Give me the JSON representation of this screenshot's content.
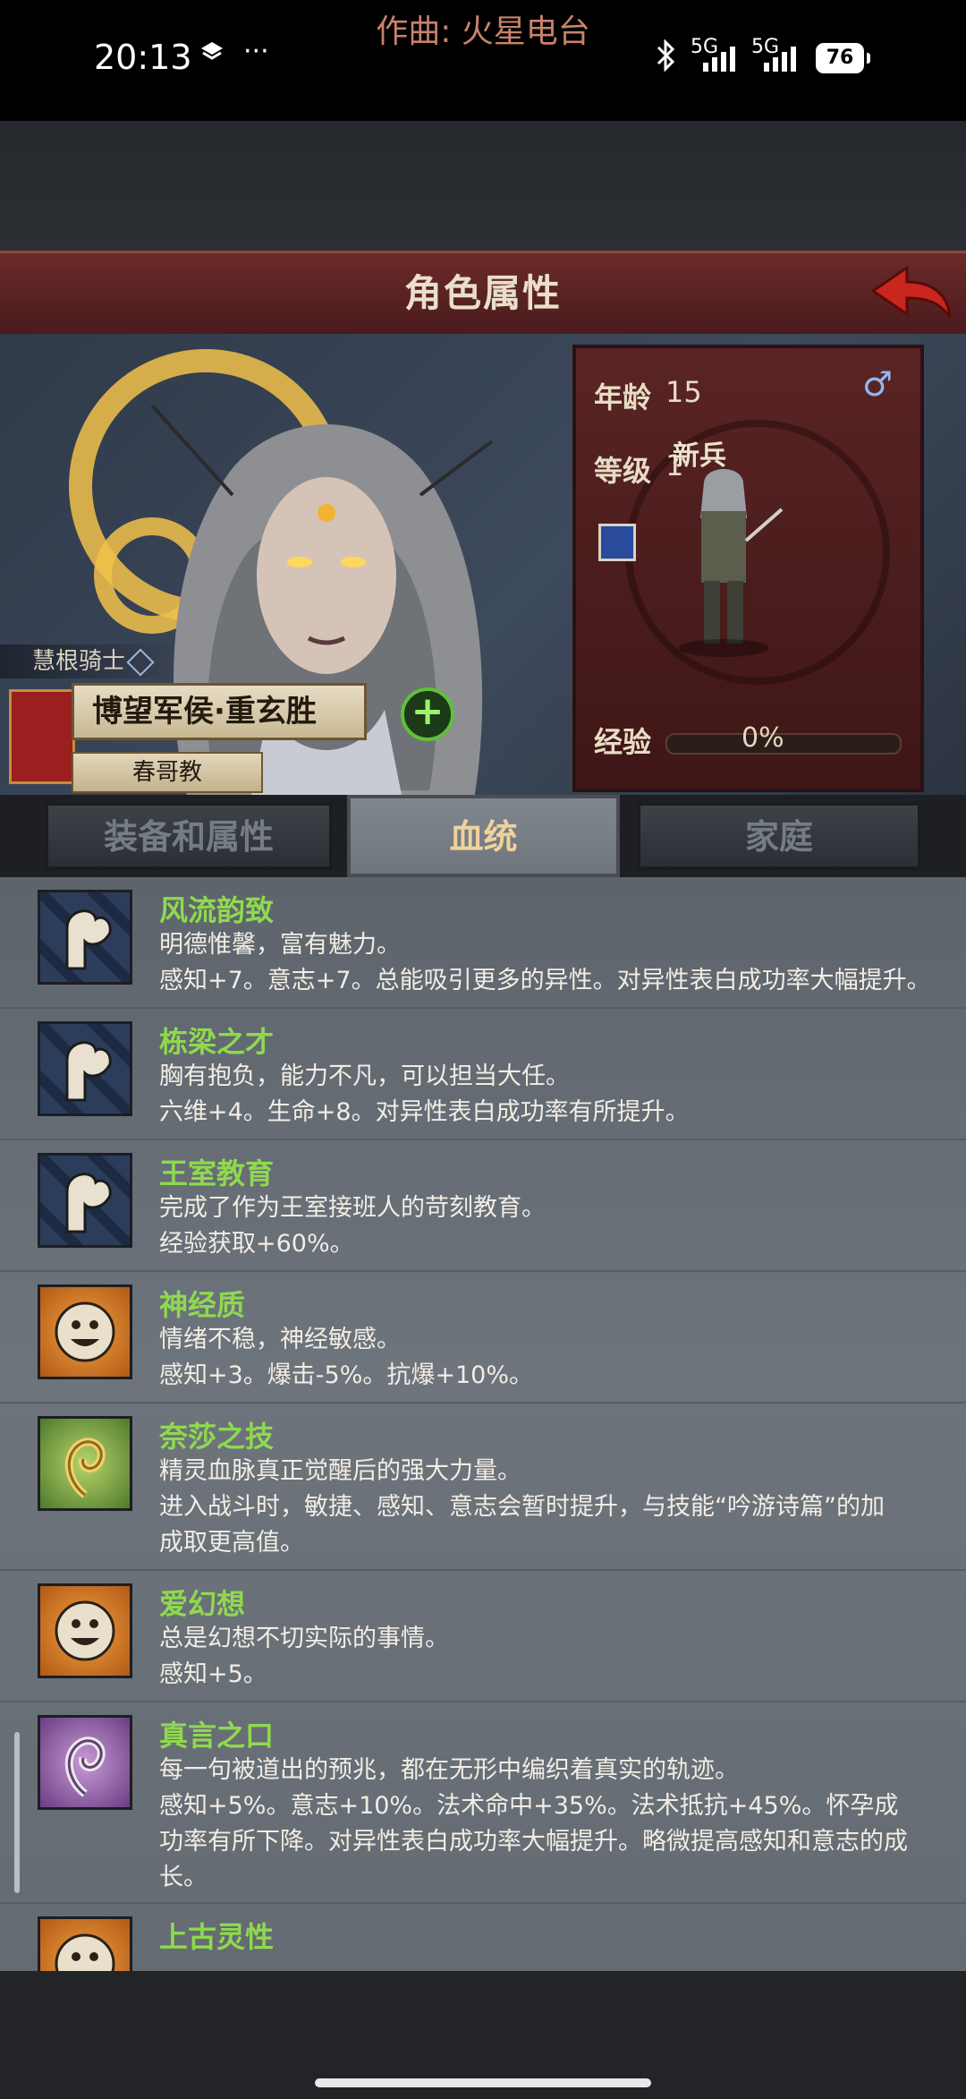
{
  "status_bar": {
    "time": "20:13",
    "lyric": "作曲: 火星电台",
    "ellipsis": "···",
    "network1": "5G",
    "network2": "5G",
    "battery": "76"
  },
  "header": {
    "title": "角色属性",
    "back_icon": "red-back-arrow-icon"
  },
  "character": {
    "class_title": "慧根骑士",
    "name": "博望军侯·重玄胜",
    "religion": "春哥教"
  },
  "stats": {
    "age_label": "年龄",
    "age_value": "15",
    "level_label": "等级",
    "level_value": "1",
    "unit_name": "新兵",
    "exp_label": "经验",
    "exp_value": "0%",
    "exp_progress": 0
  },
  "tabs": [
    {
      "label": "装备和属性",
      "active": false
    },
    {
      "label": "血统",
      "active": true
    },
    {
      "label": "家庭",
      "active": false
    }
  ],
  "traits": [
    {
      "name": "风流韵致",
      "icon": "arm-muscle-icon",
      "lines": [
        "明德惟馨，富有魅力。",
        "感知+7。意志+7。总能吸引更多的异性。对异性表白成功率大幅提升。"
      ]
    },
    {
      "name": "栋梁之才",
      "icon": "arm-muscle-icon",
      "lines": [
        "胸有抱负，能力不凡，可以担当大任。",
        "六维+4。生命+8。对异性表白成功率有所提升。"
      ]
    },
    {
      "name": "王室教育",
      "icon": "arm-muscle-icon",
      "lines": [
        "完成了作为王室接班人的苛刻教育。",
        "经验获取+60%。"
      ]
    },
    {
      "name": "神经质",
      "icon": "smiley-face-icon",
      "lines": [
        "情绪不稳，神经敏感。",
        "感知+3。爆击-5%。抗爆+10%。"
      ]
    },
    {
      "name": "奈莎之技",
      "icon": "golden-swirl-icon",
      "lines": [
        "精灵血脉真正觉醒后的强大力量。",
        "进入战斗时，敏捷、感知、意志会暂时提升，与技能“吟游诗篇”的加",
        "成取更高值。"
      ]
    },
    {
      "name": "爱幻想",
      "icon": "smiley-face-icon",
      "lines": [
        "总是幻想不切实际的事情。",
        "感知+5。"
      ]
    },
    {
      "name": "真言之口",
      "icon": "purple-swirl-icon",
      "lines": [
        "每一句被道出的预兆，都在无形中编织着真实的轨迹。",
        "感知+5%。意志+10%。法术命中+35%。法术抵抗+45%。怀孕成",
        "功率有所下降。对异性表白成功率大幅提升。略微提高感知和意志的成",
        "长。"
      ]
    },
    {
      "name": "上古灵性",
      "icon": "smiley-face-icon",
      "lines": []
    }
  ]
}
